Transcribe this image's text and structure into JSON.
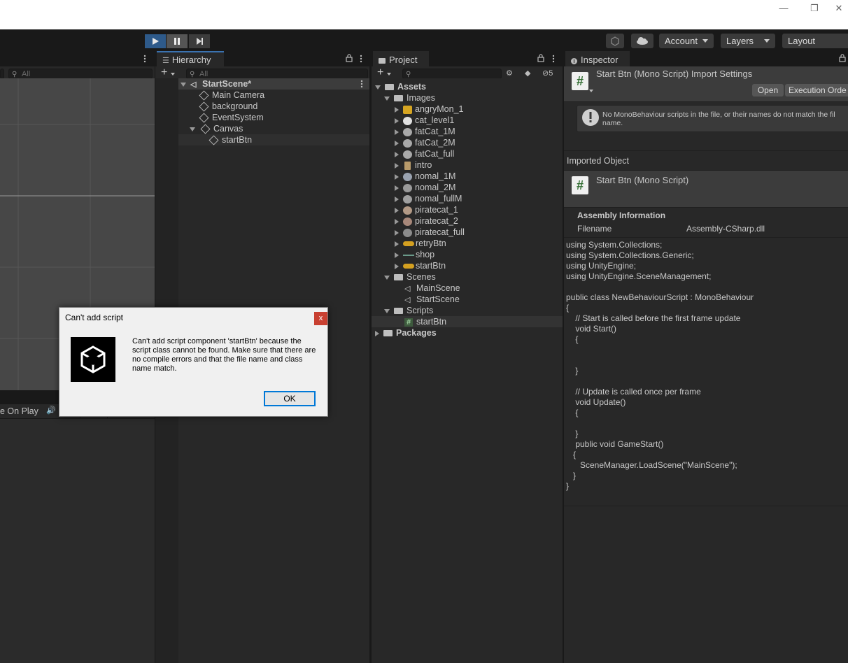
{
  "window": {
    "minimize_glyph": "—",
    "restore_glyph": "❐",
    "close_glyph": "✕"
  },
  "toolbar": {
    "account_label": "Account",
    "layers_label": "Layers",
    "layout_label": "Layout"
  },
  "scene_view": {
    "search_placeholder": "All",
    "bottom_label": "e On Play"
  },
  "hierarchy": {
    "tab_label": "Hierarchy",
    "search_placeholder": "All",
    "scene_name": "StartScene*",
    "items": [
      "Main Camera",
      "background",
      "EventSystem",
      "Canvas",
      "startBtn"
    ]
  },
  "project": {
    "tab_label": "Project",
    "hidden_count": "5",
    "assets_label": "Assets",
    "images_label": "Images",
    "images": [
      "angryMon_1",
      "cat_level1",
      "fatCat_1M",
      "fatCat_2M",
      "fatCat_full",
      "intro",
      "nomal_1M",
      "nomal_2M",
      "nomal_fullM",
      "piratecat_1",
      "piratecat_2",
      "piratecat_full",
      "retryBtn",
      "shop",
      "startBtn"
    ],
    "scenes_label": "Scenes",
    "scenes": [
      "MainScene",
      "StartScene"
    ],
    "scripts_label": "Scripts",
    "scripts": [
      "startBtn"
    ],
    "packages_label": "Packages"
  },
  "inspector": {
    "tab_label": "Inspector",
    "header_title": "Start Btn (Mono Script) Import Settings",
    "open_button": "Open",
    "execution_order_button": "Execution Orde",
    "warning_text": "No MonoBehaviour scripts in the file, or their names do not match the fil",
    "warning_text_2": "name.",
    "imported_object_label": "Imported Object",
    "object_title": "Start Btn (Mono Script)",
    "assembly_info_label": "Assembly Information",
    "filename_label": "Filename",
    "filename_value": "Assembly-CSharp.dll",
    "code_lines": [
      "using System.Collections;",
      "using System.Collections.Generic;",
      "using UnityEngine;",
      "using UnityEngine.SceneManagement;",
      "",
      "public class NewBehaviourScript : MonoBehaviour",
      "{",
      "    // Start is called before the first frame update",
      "    void Start()",
      "    {",
      "",
      "",
      "    }",
      "",
      "    // Update is called once per frame",
      "    void Update()",
      "    {",
      "",
      "    }",
      "    public void GameStart()",
      "   {",
      "      SceneManager.LoadScene(\"MainScene\");",
      "   }",
      "}"
    ]
  },
  "dialog": {
    "title": "Can't add script",
    "close_label": "x",
    "message": "Can't add script component 'startBtn' because the script class cannot be found. Make sure that there are no compile errors and that the file name and class name match.",
    "ok_label": "OK"
  }
}
